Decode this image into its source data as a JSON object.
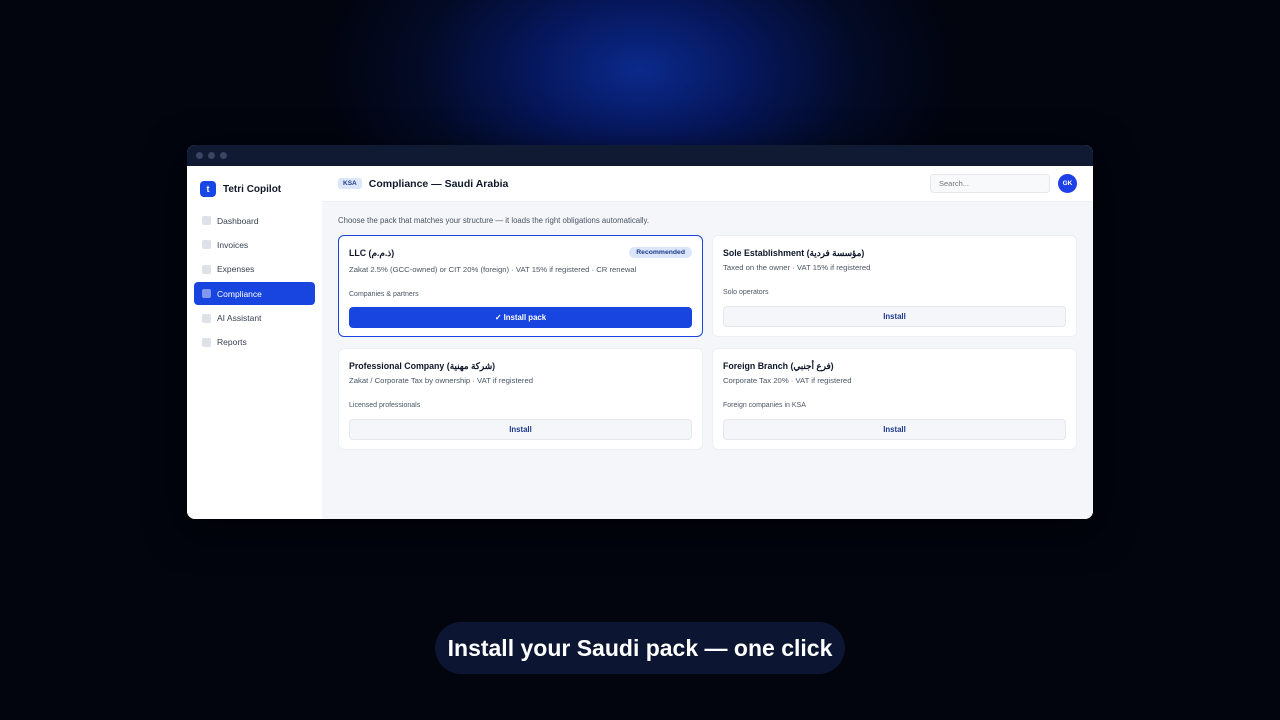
{
  "app": {
    "brand_logo": "t",
    "brand_name": "Tetri Copilot"
  },
  "sidebar": {
    "items": [
      {
        "label": "Dashboard",
        "active": false
      },
      {
        "label": "Invoices",
        "active": false
      },
      {
        "label": "Expenses",
        "active": false
      },
      {
        "label": "Compliance",
        "active": true
      },
      {
        "label": "AI Assistant",
        "active": false
      },
      {
        "label": "Reports",
        "active": false
      }
    ]
  },
  "header": {
    "country_badge": "KSA",
    "title": "Compliance — Saudi Arabia",
    "search_placeholder": "Search...",
    "avatar_initials": "GK"
  },
  "main": {
    "subtitle": "Choose the pack that matches your structure — it loads the right obligations automatically.",
    "packs": [
      {
        "title": "LLC (ذ.م.م)",
        "badge": "Recommended",
        "description": "Zakat 2.5% (GCC-owned) or CIT 20% (foreign) · VAT 15% if registered · CR renewal",
        "audience": "Companies & partners",
        "button": "✓ Install pack",
        "selected": true
      },
      {
        "title": "Sole Establishment (مؤسسة فردية)",
        "description": "Taxed on the owner · VAT 15% if registered",
        "audience": "Solo operators",
        "button": "Install",
        "selected": false
      },
      {
        "title": "Professional Company (شركة مهنية)",
        "description": "Zakat / Corporate Tax by ownership · VAT if registered",
        "audience": "Licensed professionals",
        "button": "Install",
        "selected": false
      },
      {
        "title": "Foreign Branch (فرع أجنبي)",
        "description": "Corporate Tax 20% · VAT if registered",
        "audience": "Foreign companies in KSA",
        "button": "Install",
        "selected": false
      }
    ]
  },
  "caption": "Install your Saudi pack — one click",
  "colors": {
    "accent": "#1845e0",
    "badge_bg": "#dbe6fb",
    "background": "#02040e"
  }
}
